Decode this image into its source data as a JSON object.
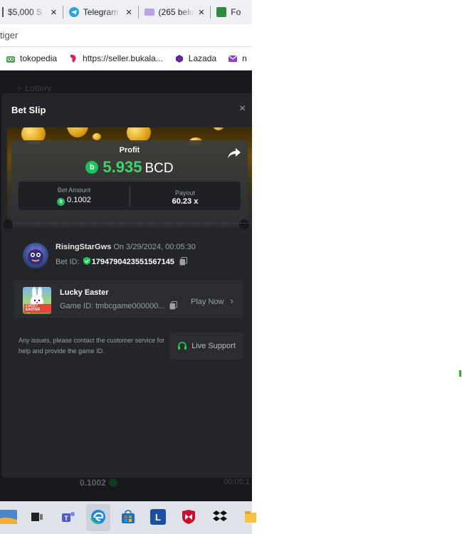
{
  "browser": {
    "tabs": [
      {
        "title": "$5,000 S",
        "icon": "dollar-tab-icon"
      },
      {
        "title": "Telegram",
        "icon": "telegram-icon",
        "color": "#2aa3e1"
      },
      {
        "title": "(265 belu",
        "icon": "mail-icon",
        "color": "#b9a3e6"
      },
      {
        "title": "Fo",
        "icon": "bc-tab-icon",
        "color": "#2d8c3b"
      }
    ],
    "url_text": "tiger",
    "bookmarks": [
      {
        "label": "tokopedia",
        "icon": "tokopedia-icon"
      },
      {
        "label": "https://seller.bukala...",
        "icon": "bukalapak-icon"
      },
      {
        "label": "Lazada",
        "icon": "lazada-icon"
      },
      {
        "label": "n",
        "icon": "mail-icon"
      }
    ]
  },
  "page": {
    "ghost_lottery": "Lottery",
    "ghost_amount": "0.1002",
    "ghost_time": "00:05:1"
  },
  "bet_slip": {
    "title": "Bet Slip",
    "close": "×",
    "profit_label": "Profit",
    "profit_amount": "5.935",
    "currency": "BCD",
    "bet_amount_label": "Bet Amount",
    "bet_amount": "0.1002",
    "payout_label": "Payout",
    "payout": "60.23 x",
    "player": "RisingStarGws",
    "when": "On 3/29/2024, 00:05:30",
    "bet_id_label": "Bet ID:",
    "bet_id": "179479042355156714​5",
    "game_name": "Lucky Easter",
    "game_id": "Game ID: tmbcgame000000...",
    "play_now": "Play Now",
    "support_text": "Any issues, please contact the customer service for help and provide the game ID.",
    "live_support": "Live Support",
    "thumb_label": "LUCKY EASTER"
  },
  "colors": {
    "profit_green": "#3ed36b",
    "bcd_coin": "#18c45a",
    "modal_bg": "#232528"
  }
}
